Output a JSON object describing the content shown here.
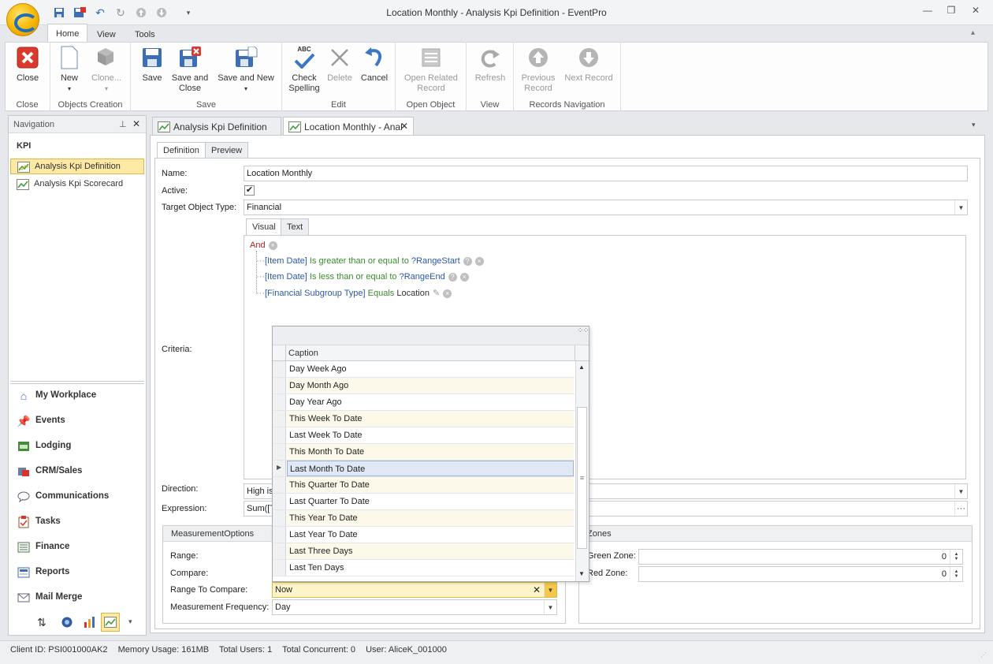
{
  "window": {
    "title": "Location Monthly - Analysis Kpi Definition - EventPro"
  },
  "ribbon": {
    "tabs": [
      "Home",
      "View",
      "Tools"
    ],
    "groups": {
      "close": {
        "label": "Close",
        "buttons": {
          "close": "Close"
        }
      },
      "objects_creation": {
        "label": "Objects Creation",
        "buttons": {
          "new": "New",
          "clone": "Clone..."
        }
      },
      "save": {
        "label": "Save",
        "buttons": {
          "save": "Save",
          "save_close_1": "Save and",
          "save_close_2": "Close",
          "save_new": "Save and New"
        }
      },
      "edit": {
        "label": "Edit",
        "buttons": {
          "check_1": "Check",
          "check_2": "Spelling",
          "check_abc": "ABC",
          "delete": "Delete",
          "cancel": "Cancel"
        }
      },
      "open_object": {
        "label": "Open Object",
        "buttons": {
          "open_related_1": "Open Related",
          "open_related_2": "Record"
        }
      },
      "view": {
        "label": "View",
        "buttons": {
          "refresh": "Refresh"
        }
      },
      "records_navigation": {
        "label": "Records Navigation",
        "buttons": {
          "prev_1": "Previous",
          "prev_2": "Record",
          "next": "Next Record"
        }
      }
    }
  },
  "navigation": {
    "title": "Navigation",
    "section": "KPI",
    "items": [
      "Analysis Kpi Definition",
      "Analysis Kpi Scorecard"
    ],
    "workplaces": [
      "My Workplace",
      "Events",
      "Lodging",
      "CRM/Sales",
      "Communications",
      "Tasks",
      "Finance",
      "Reports",
      "Mail Merge"
    ]
  },
  "doc_tabs": [
    "Analysis Kpi Definition",
    "Location Monthly - Anal"
  ],
  "form": {
    "sub_tabs": [
      "Definition",
      "Preview"
    ],
    "labels": {
      "name": "Name:",
      "active": "Active:",
      "target": "Target Object Type:",
      "criteria": "Criteria:",
      "direction": "Direction:",
      "expression": "Expression:"
    },
    "name_value": "Location Monthly",
    "target_value": "Financial",
    "direction_value": "High is",
    "expression_value": "Sum([T",
    "criteria_tabs": [
      "Visual",
      "Text"
    ],
    "criteria": {
      "root": "And",
      "conditions": [
        {
          "field": "[Item Date]",
          "op": "Is greater than or equal to",
          "value": "?RangeStart"
        },
        {
          "field": "[Item Date]",
          "op": "Is less than or equal to",
          "value": "?RangeEnd"
        },
        {
          "field": "[Financial Subgroup Type]",
          "op": "Equals",
          "value": "Location"
        }
      ]
    }
  },
  "measurement": {
    "title": "MeasurementOptions",
    "labels": {
      "range": "Range:",
      "compare": "Compare:",
      "range_to_compare": "Range To Compare:",
      "frequency": "Measurement Frequency:"
    },
    "range_to_compare_value": "Now",
    "frequency_value": "Day"
  },
  "zones": {
    "title": "Zones",
    "green_label": "Green Zone:",
    "red_label": "Red Zone:",
    "green_value": "0",
    "red_value": "0"
  },
  "popup": {
    "column": "Caption",
    "rows": [
      "Day Week Ago",
      "Day Month Ago",
      "Day Year Ago",
      "This Week To Date",
      "Last Week To Date",
      "This Month To Date",
      "Last Month To Date",
      "This Quarter To Date",
      "Last Quarter To Date",
      "This Year To Date",
      "Last Year To Date",
      "Last Three Days",
      "Last Ten Days"
    ],
    "selected_row": "Last Month To Date"
  },
  "status": {
    "client_id": "Client ID: PSI001000AK2",
    "memory": "Memory Usage: 161MB",
    "total_users": "Total Users: 1",
    "total_concurrent": "Total Concurrent: 0",
    "user": "User: AliceK_001000"
  },
  "colors": {
    "accent_selection": "#fde9a3",
    "title_red": "#d93a2b",
    "link_blue": "#2b58a8",
    "operator_green": "#3a8a2e"
  }
}
